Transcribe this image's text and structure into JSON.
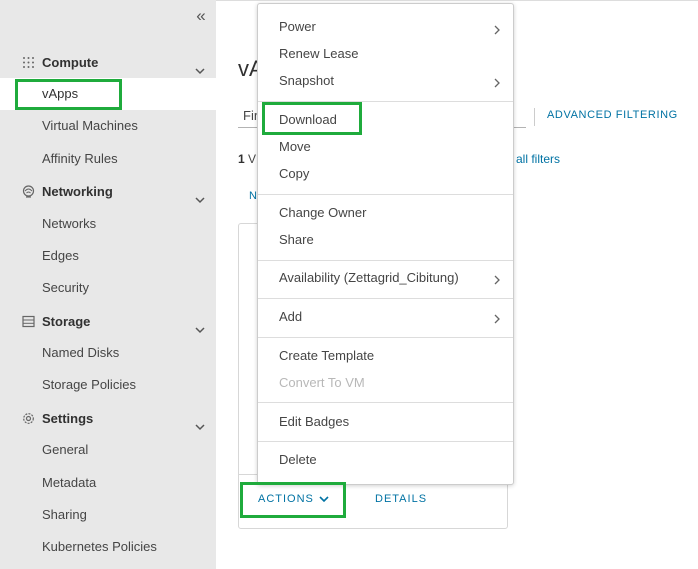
{
  "sidebar": {
    "sections": [
      {
        "label": "Compute",
        "icon": "grid-icon",
        "items": [
          "vApps",
          "Virtual Machines",
          "Affinity Rules"
        ]
      },
      {
        "label": "Networking",
        "icon": "network-icon",
        "items": [
          "Networks",
          "Edges",
          "Security"
        ]
      },
      {
        "label": "Storage",
        "icon": "storage-icon",
        "items": [
          "Named Disks",
          "Storage Policies"
        ]
      },
      {
        "label": "Settings",
        "icon": "gear-icon",
        "items": [
          "General",
          "Metadata",
          "Sharing",
          "Kubernetes Policies"
        ]
      }
    ],
    "active_item": "vApps"
  },
  "main": {
    "title": "vA",
    "filter_value": "Fir",
    "advanced_filtering": "ADVANCED FILTERING",
    "count_number": "1",
    "count_text": " V",
    "all_filters": "all filters",
    "n_button": "N"
  },
  "card": {
    "actions_label": "ACTIONS",
    "details_label": "DETAILS"
  },
  "menu": {
    "groups": [
      [
        {
          "label": "Power",
          "submenu": true
        },
        {
          "label": "Renew Lease",
          "submenu": false
        },
        {
          "label": "Snapshot",
          "submenu": true
        }
      ],
      [
        {
          "label": "Download",
          "submenu": false
        },
        {
          "label": "Move",
          "submenu": false
        },
        {
          "label": "Copy",
          "submenu": false
        }
      ],
      [
        {
          "label": "Change Owner",
          "submenu": false
        },
        {
          "label": "Share",
          "submenu": false
        }
      ],
      [
        {
          "label": "Availability (Zettagrid_Cibitung)",
          "submenu": true
        }
      ],
      [
        {
          "label": "Add",
          "submenu": true
        }
      ],
      [
        {
          "label": "Create Template",
          "submenu": false
        },
        {
          "label": "Convert To VM",
          "submenu": false,
          "disabled": true
        }
      ],
      [
        {
          "label": "Edit Badges",
          "submenu": false
        }
      ],
      [
        {
          "label": "Delete",
          "submenu": false
        }
      ]
    ]
  },
  "colors": {
    "link": "#0072a3",
    "highlight": "#1fab3c",
    "sidebar_bg": "#e8e8e8"
  }
}
